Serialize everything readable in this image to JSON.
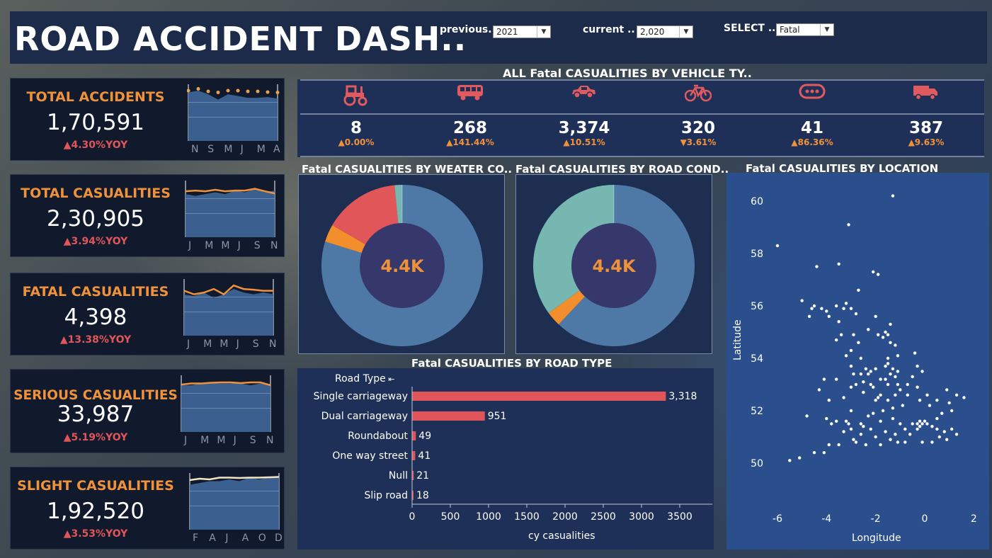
{
  "header": {
    "title": "ROAD ACCIDENT DASH..",
    "filters": [
      {
        "label": "previous..",
        "value": "2021"
      },
      {
        "label": "current ..",
        "value": "2,020"
      },
      {
        "label": "SELECT ..",
        "value": "Fatal"
      }
    ]
  },
  "kpis": [
    {
      "label": "TOTAL ACCIDENTS",
      "value": "1,70,591",
      "yoy": "▲4.30%YOY",
      "ticks": [
        "N",
        "S",
        "M",
        "J",
        "M",
        "A"
      ]
    },
    {
      "label": "TOTAL CASUALITIES",
      "value": "2,30,905",
      "yoy": "▲3.94%YOY",
      "ticks": [
        "J",
        "M",
        "M",
        "J",
        "S",
        "N"
      ]
    },
    {
      "label": "FATAL CASUALITIES",
      "value": "4,398",
      "yoy": "▲13.38%YOY",
      "ticks": [
        "J",
        "M",
        "M",
        "J",
        "S",
        "N"
      ]
    },
    {
      "label": "SERIOUS CASUALITIES",
      "value": "33,987",
      "yoy": "▲5.19%YOY",
      "ticks": [
        "J",
        "M",
        "M",
        "J",
        "S",
        "N"
      ]
    },
    {
      "label": "SLIGHT CASUALITIES",
      "value": "1,92,520",
      "yoy": "▲3.53%YOY",
      "ticks": [
        "F",
        "A",
        "J",
        "A",
        "O",
        "D"
      ]
    }
  ],
  "vehicle": {
    "title": "ALL Fatal CASUALITIES BY VEHICLE TY..",
    "items": [
      {
        "icon": "tractor-icon",
        "value": "8",
        "change": "▲0.00%"
      },
      {
        "icon": "bus-icon",
        "value": "268",
        "change": "▲141.44%"
      },
      {
        "icon": "car-icon",
        "value": "3,374",
        "change": "▲10.51%"
      },
      {
        "icon": "bicycle-icon",
        "value": "320",
        "change": "▼3.61%"
      },
      {
        "icon": "other-vehicle-icon",
        "value": "41",
        "change": "▲86.36%"
      },
      {
        "icon": "van-icon",
        "value": "387",
        "change": "▲9.63%"
      }
    ],
    "icon_color": "#e05a5f",
    "change_color": "#f0923a"
  },
  "donuts": [
    {
      "title": "Fatal CASUALITIES BY WEATER CO..",
      "center": "4.4K"
    },
    {
      "title": "Fatal CASUALITIES BY ROAD COND..",
      "center": "4.4K"
    }
  ],
  "location": {
    "title": "Fatal CASUALITIES BY LOCATION",
    "xlabel": "Longitude",
    "ylabel": "Latitude",
    "xticks": [
      "-6",
      "-4",
      "-2",
      "0",
      "2"
    ],
    "yticks": [
      "60",
      "58",
      "56",
      "54",
      "52",
      "50"
    ]
  },
  "roadtype": {
    "title": "Fatal CASUALITIES BY ROAD TYPE",
    "header": "Road Type",
    "xlabel": "cy casualities",
    "xticks": [
      "0",
      "500",
      "1000",
      "1500",
      "2000",
      "2500",
      "3000",
      "3500"
    ]
  },
  "chart_data": [
    {
      "type": "bar",
      "title": "Fatal CASUALITIES BY ROAD TYPE",
      "categories": [
        "Single carriageway",
        "Dual carriageway",
        "Roundabout",
        "One way street",
        "Null",
        "Slip road"
      ],
      "values": [
        3318,
        951,
        49,
        41,
        21,
        18
      ],
      "value_labels": [
        "3,318",
        "951",
        "49",
        "41",
        "21",
        "18"
      ],
      "xlabel": "cy casualities",
      "xlim": [
        0,
        3700
      ],
      "color": "#e0555a"
    },
    {
      "type": "pie",
      "title": "Fatal CASUALITIES BY WEATER CO..",
      "center_label": "4.4K",
      "values": [
        79,
        3.5,
        15,
        1.5
      ],
      "colors": [
        "#4e79a7",
        "#f28e2b",
        "#e15759",
        "#76b7b2"
      ]
    },
    {
      "type": "pie",
      "title": "Fatal CASUALITIES BY ROAD COND..",
      "center_label": "4.4K",
      "values": [
        62,
        3,
        35
      ],
      "colors": [
        "#4e79a7",
        "#f28e2b",
        "#76b7b2"
      ]
    },
    {
      "type": "scatter",
      "title": "Fatal CASUALITIES BY LOCATION",
      "xlabel": "Longitude",
      "ylabel": "Latitude",
      "xlim": [
        -6.6,
        2
      ],
      "ylim": [
        49.5,
        60.7
      ],
      "points": [
        [
          -1.3,
          60.2
        ],
        [
          -3.1,
          59.1
        ],
        [
          -6.0,
          58.3
        ],
        [
          -3.5,
          57.6
        ],
        [
          -4.4,
          57.5
        ],
        [
          -2.1,
          57.3
        ],
        [
          -1.9,
          57.2
        ],
        [
          -2.7,
          56.6
        ],
        [
          -5.0,
          56.2
        ],
        [
          -4.5,
          56.0
        ],
        [
          -4.2,
          55.9
        ],
        [
          -4.0,
          55.8
        ],
        [
          -3.6,
          56.0
        ],
        [
          -3.3,
          55.9
        ],
        [
          -3.0,
          55.9
        ],
        [
          -3.2,
          56.1
        ],
        [
          -2.8,
          55.7
        ],
        [
          -4.7,
          55.6
        ],
        [
          -3.9,
          55.6
        ],
        [
          -3.5,
          55.4
        ],
        [
          -4.6,
          55.9
        ],
        [
          -1.6,
          55.0
        ],
        [
          -1.5,
          54.9
        ],
        [
          -1.7,
          54.8
        ],
        [
          -1.4,
          54.6
        ],
        [
          -1.2,
          54.5
        ],
        [
          -1.9,
          54.9
        ],
        [
          -2.9,
          54.9
        ],
        [
          -2.7,
          54.6
        ],
        [
          -3.0,
          54.3
        ],
        [
          -2.6,
          54.0
        ],
        [
          -3.2,
          54.1
        ],
        [
          -1.1,
          54.1
        ],
        [
          -0.4,
          54.2
        ],
        [
          -1.5,
          54.0
        ],
        [
          -2.2,
          53.5
        ],
        [
          -2.4,
          53.6
        ],
        [
          -2.3,
          53.4
        ],
        [
          -2.0,
          53.6
        ],
        [
          -2.6,
          53.4
        ],
        [
          -2.9,
          53.4
        ],
        [
          -3.0,
          53.7
        ],
        [
          -1.5,
          53.8
        ],
        [
          -1.6,
          53.7
        ],
        [
          -1.3,
          53.6
        ],
        [
          -1.1,
          53.5
        ],
        [
          -1.4,
          53.4
        ],
        [
          -1.2,
          53.3
        ],
        [
          -0.3,
          53.7
        ],
        [
          -0.5,
          53.3
        ],
        [
          -0.1,
          53.5
        ],
        [
          -1.1,
          53.0
        ],
        [
          -1.5,
          53.0
        ],
        [
          -2.1,
          52.9
        ],
        [
          -2.2,
          53.0
        ],
        [
          -1.9,
          52.5
        ],
        [
          -2.0,
          52.4
        ],
        [
          -1.8,
          52.6
        ],
        [
          -1.5,
          52.4
        ],
        [
          -1.2,
          52.6
        ],
        [
          -0.9,
          52.2
        ],
        [
          -0.7,
          52.6
        ],
        [
          -1.3,
          52.1
        ],
        [
          -2.5,
          52.7
        ],
        [
          -3.0,
          52.9
        ],
        [
          -3.3,
          52.5
        ],
        [
          -3.9,
          52.4
        ],
        [
          -4.3,
          52.8
        ],
        [
          -3.6,
          53.2
        ],
        [
          -4.1,
          53.2
        ],
        [
          -3.0,
          52.0
        ],
        [
          -3.2,
          51.6
        ],
        [
          -3.6,
          51.6
        ],
        [
          -4.0,
          51.7
        ],
        [
          -4.8,
          51.8
        ],
        [
          -3.8,
          51.5
        ],
        [
          -3.1,
          51.5
        ],
        [
          -2.6,
          51.5
        ],
        [
          -2.5,
          51.4
        ],
        [
          -2.3,
          51.8
        ],
        [
          -2.1,
          51.9
        ],
        [
          -1.8,
          51.6
        ],
        [
          -1.3,
          51.7
        ],
        [
          -1.0,
          51.5
        ],
        [
          -0.8,
          51.3
        ],
        [
          -0.5,
          51.5
        ],
        [
          -0.3,
          51.5
        ],
        [
          -0.2,
          51.4
        ],
        [
          -0.1,
          51.5
        ],
        [
          0.0,
          51.6
        ],
        [
          0.1,
          51.5
        ],
        [
          -0.2,
          51.6
        ],
        [
          -0.3,
          51.3
        ],
        [
          0.3,
          51.4
        ],
        [
          0.5,
          51.3
        ],
        [
          0.8,
          51.2
        ],
        [
          1.1,
          51.3
        ],
        [
          1.3,
          51.1
        ],
        [
          0.5,
          51.7
        ],
        [
          0.7,
          51.9
        ],
        [
          1.1,
          52.0
        ],
        [
          1.3,
          52.6
        ],
        [
          1.6,
          52.5
        ],
        [
          0.9,
          52.8
        ],
        [
          0.2,
          52.2
        ],
        [
          0.1,
          52.6
        ],
        [
          -0.3,
          52.9
        ],
        [
          -2.0,
          51.0
        ],
        [
          -2.9,
          50.9
        ],
        [
          -3.5,
          50.7
        ],
        [
          -4.1,
          50.4
        ],
        [
          -4.5,
          50.4
        ],
        [
          -5.1,
          50.2
        ],
        [
          -5.5,
          50.1
        ],
        [
          -1.4,
          50.9
        ],
        [
          -1.1,
          50.8
        ],
        [
          -0.8,
          50.8
        ],
        [
          -0.1,
          50.8
        ],
        [
          0.3,
          50.8
        ],
        [
          -2.4,
          50.7
        ],
        [
          -1.8,
          50.7
        ],
        [
          -3.9,
          50.7
        ],
        [
          -2.8,
          50.8
        ],
        [
          -1.6,
          51.2
        ],
        [
          -1.2,
          51.1
        ],
        [
          -0.6,
          51.1
        ],
        [
          0.6,
          51.0
        ],
        [
          0.9,
          50.9
        ],
        [
          -3.3,
          51.2
        ],
        [
          -2.6,
          51.1
        ],
        [
          -3.0,
          51.3
        ],
        [
          -2.2,
          51.3
        ],
        [
          -1.7,
          52.0
        ],
        [
          -1.6,
          53.2
        ],
        [
          -2.8,
          53.0
        ],
        [
          -1.0,
          52.8
        ],
        [
          -0.7,
          53.0
        ],
        [
          -1.8,
          53.2
        ],
        [
          -2.5,
          53.1
        ],
        [
          -0.2,
          52.4
        ],
        [
          0.5,
          52.4
        ],
        [
          1.0,
          52.3
        ],
        [
          -1.4,
          55.3
        ],
        [
          -2.0,
          55.6
        ],
        [
          -2.3,
          55.1
        ],
        [
          -3.6,
          54.7
        ],
        [
          -3.4,
          54.9
        ]
      ]
    }
  ]
}
